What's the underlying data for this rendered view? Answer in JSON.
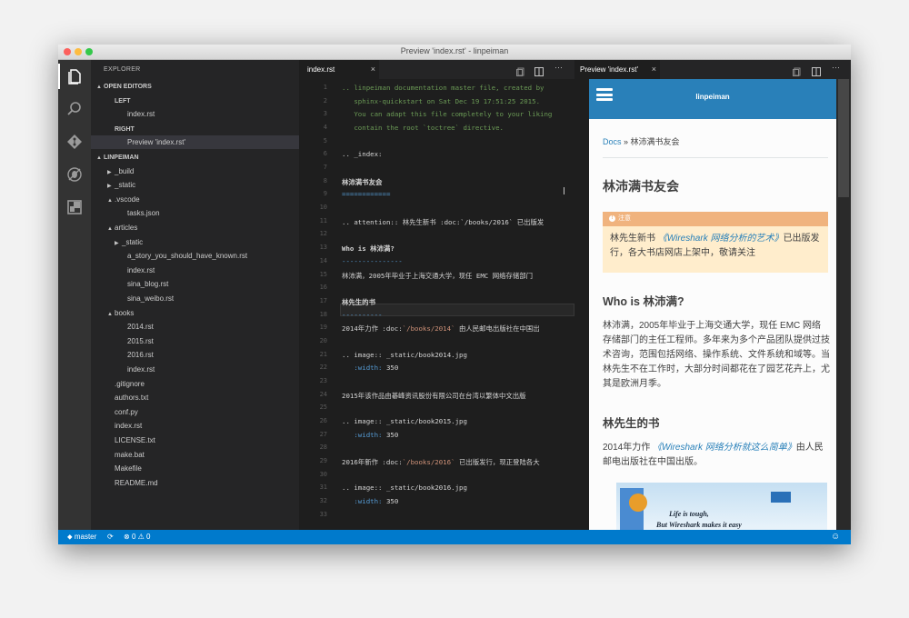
{
  "window": {
    "title": "Preview 'index.rst' - linpeiman"
  },
  "activity_bar": {
    "icons": [
      "files-icon",
      "search-icon",
      "git-icon",
      "debug-icon",
      "extensions-icon"
    ]
  },
  "sidebar": {
    "title": "EXPLORER",
    "items": [
      {
        "label": "OPEN EDITORS",
        "indent": 0,
        "twisty": "▲",
        "bold": true
      },
      {
        "label": "LEFT",
        "indent": 1,
        "twisty": "",
        "bold": true
      },
      {
        "label": "index.rst",
        "indent": 2,
        "twisty": ""
      },
      {
        "label": "RIGHT",
        "indent": 1,
        "twisty": "",
        "bold": true
      },
      {
        "label": "Preview 'index.rst'",
        "indent": 2,
        "twisty": "",
        "selected": true
      },
      {
        "label": "LINPEIMAN",
        "indent": 0,
        "twisty": "▲",
        "bold": true
      },
      {
        "label": "_build",
        "indent": 1,
        "twisty": "▶"
      },
      {
        "label": "_static",
        "indent": 1,
        "twisty": "▶"
      },
      {
        "label": ".vscode",
        "indent": 1,
        "twisty": "▲"
      },
      {
        "label": "tasks.json",
        "indent": 2,
        "twisty": ""
      },
      {
        "label": "articles",
        "indent": 1,
        "twisty": "▲"
      },
      {
        "label": "_static",
        "indent": 2,
        "twisty": "▶"
      },
      {
        "label": "a_story_you_should_have_known.rst",
        "indent": 2,
        "twisty": ""
      },
      {
        "label": "index.rst",
        "indent": 2,
        "twisty": ""
      },
      {
        "label": "sina_blog.rst",
        "indent": 2,
        "twisty": ""
      },
      {
        "label": "sina_weibo.rst",
        "indent": 2,
        "twisty": ""
      },
      {
        "label": "books",
        "indent": 1,
        "twisty": "▲"
      },
      {
        "label": "2014.rst",
        "indent": 2,
        "twisty": ""
      },
      {
        "label": "2015.rst",
        "indent": 2,
        "twisty": ""
      },
      {
        "label": "2016.rst",
        "indent": 2,
        "twisty": ""
      },
      {
        "label": "index.rst",
        "indent": 2,
        "twisty": ""
      },
      {
        "label": ".gitignore",
        "indent": 1,
        "twisty": ""
      },
      {
        "label": "authors.txt",
        "indent": 1,
        "twisty": ""
      },
      {
        "label": "conf.py",
        "indent": 1,
        "twisty": ""
      },
      {
        "label": "index.rst",
        "indent": 1,
        "twisty": ""
      },
      {
        "label": "LICENSE.txt",
        "indent": 1,
        "twisty": ""
      },
      {
        "label": "make.bat",
        "indent": 1,
        "twisty": ""
      },
      {
        "label": "Makefile",
        "indent": 1,
        "twisty": ""
      },
      {
        "label": "README.md",
        "indent": 1,
        "twisty": ""
      }
    ]
  },
  "editor": {
    "tab": {
      "label": "index.rst",
      "close": "×"
    },
    "lines": [
      {
        "n": "1",
        "t": ".. linpeiman documentation master file, created by",
        "c": "com"
      },
      {
        "n": "2",
        "t": "   sphinx-quickstart on Sat Dec 19 17:51:25 2015.",
        "c": "com"
      },
      {
        "n": "3",
        "t": "   You can adapt this file completely to your liking",
        "c": "com"
      },
      {
        "n": "4",
        "t": "   contain the root `toctree` directive.",
        "c": "com"
      },
      {
        "n": "5",
        "t": "",
        "c": ""
      },
      {
        "n": "6",
        "t": ".. _index:",
        "c": ""
      },
      {
        "n": "7",
        "t": "",
        "c": ""
      },
      {
        "n": "8",
        "t": "林沛满书友会",
        "c": "hd"
      },
      {
        "n": "9",
        "t": "============",
        "c": "ul"
      },
      {
        "n": "10",
        "t": "",
        "c": ""
      },
      {
        "n": "11",
        "t": ".. attention:: 林先生新书 :doc:`/books/2016` 已出版发",
        "c": ""
      },
      {
        "n": "12",
        "t": "",
        "c": ""
      },
      {
        "n": "13",
        "t": "Who is 林沛满?",
        "c": "hd"
      },
      {
        "n": "14",
        "t": "---------------",
        "c": "ul"
      },
      {
        "n": "15",
        "t": "林沛满，2005年毕业于上海交通大学，现任 EMC 网络存储部门",
        "c": ""
      },
      {
        "n": "16",
        "t": "",
        "c": ""
      },
      {
        "n": "17",
        "t": "林先生的书",
        "c": "hd"
      },
      {
        "n": "18",
        "t": "----------",
        "c": "ul"
      },
      {
        "n": "19",
        "t": "2014年力作 :doc:`/books/2014` 由人民邮电出版社在中国出",
        "c": "doc"
      },
      {
        "n": "20",
        "t": "",
        "c": ""
      },
      {
        "n": "21",
        "t": ".. image:: _static/book2014.jpg",
        "c": ""
      },
      {
        "n": "22",
        "t": "   :width: 350",
        "c": "opt"
      },
      {
        "n": "23",
        "t": "",
        "c": ""
      },
      {
        "n": "24",
        "t": "2015年该作品由碁峰资讯股份有限公司在台湾以繁体中文出版",
        "c": ""
      },
      {
        "n": "25",
        "t": "",
        "c": ""
      },
      {
        "n": "26",
        "t": ".. image:: _static/book2015.jpg",
        "c": ""
      },
      {
        "n": "27",
        "t": "   :width: 350",
        "c": "opt"
      },
      {
        "n": "28",
        "t": "",
        "c": ""
      },
      {
        "n": "29",
        "t": "2016年新作 :doc:`/books/2016` 已出版发行，现正登陆各大",
        "c": "doc"
      },
      {
        "n": "30",
        "t": "",
        "c": ""
      },
      {
        "n": "31",
        "t": ".. image:: _static/book2016.jpg",
        "c": ""
      },
      {
        "n": "32",
        "t": "   :width: 350",
        "c": "opt"
      },
      {
        "n": "33",
        "t": "",
        "c": ""
      }
    ]
  },
  "preview_tab": {
    "label": "Preview 'index.rst'",
    "close": "×"
  },
  "preview": {
    "brand": "linpeiman",
    "breadcrumb_link": "Docs",
    "breadcrumb_rest": " » 林沛满书友会",
    "h1": "林沛满书友会",
    "admonition_title": "注意",
    "admonition_before": "林先生新书 ",
    "admonition_link": "《Wireshark 网络分析的艺术》",
    "admonition_after": "已出版发行，各大书店网店上架中，敬请关注",
    "h2_who": "Who is 林沛满?",
    "p_who": "林沛满，2005年毕业于上海交通大学，现任 EMC 网络存储部门的主任工程师。多年来为多个产品团队提供过技术咨询，范围包括网络、操作系统、文件系统和域等。当林先生不在工作时，大部分时间都花在了园艺花卉上，尤其是欧洲月季。",
    "h2_books": "林先生的书",
    "p_books_before": "2014年力作 ",
    "p_books_link": "《Wireshark 网络分析就这么简单》",
    "p_books_after": "由人民邮电出版社在中国出版。",
    "book_line1": "Life is tough,",
    "book_line2": "But Wireshark makes it easy"
  },
  "statusbar": {
    "branch": "master",
    "errors": "0",
    "warnings": "0"
  },
  "colors": {
    "accent": "#007acc",
    "preview_header": "#2980b9",
    "admonition": "#f0b37e"
  }
}
